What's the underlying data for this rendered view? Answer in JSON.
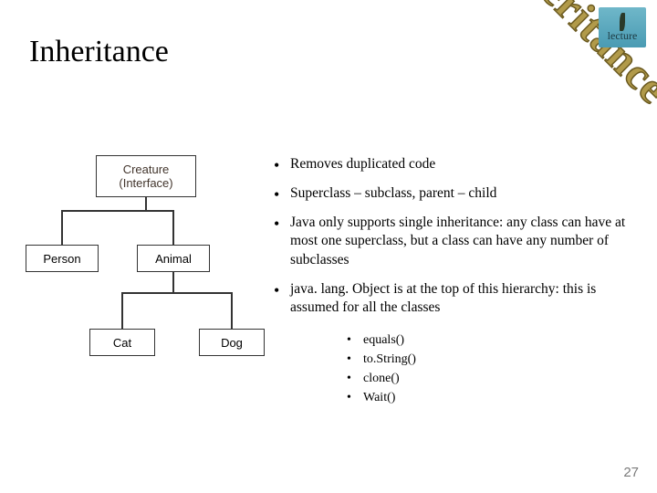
{
  "title": "Inheritance",
  "diagonal": "Inheritance",
  "badge": {
    "label": "lecture"
  },
  "diagram": {
    "top": {
      "line1": "Creature",
      "line2": "(Interface)"
    },
    "left1": "Person",
    "right1": "Animal",
    "leaf1": "Cat",
    "leaf2": "Dog"
  },
  "bullets": [
    "Removes duplicated code",
    "Superclass – subclass, parent – child",
    "Java only supports single inheritance:  any class can have at most one superclass, but a class can have any number of subclasses",
    "java. lang. Object is at the top of this hierarchy: this is assumed for all the classes"
  ],
  "subbullets": [
    "equals()",
    "to.String()",
    "clone()",
    "Wait()"
  ],
  "pagenum": "27"
}
